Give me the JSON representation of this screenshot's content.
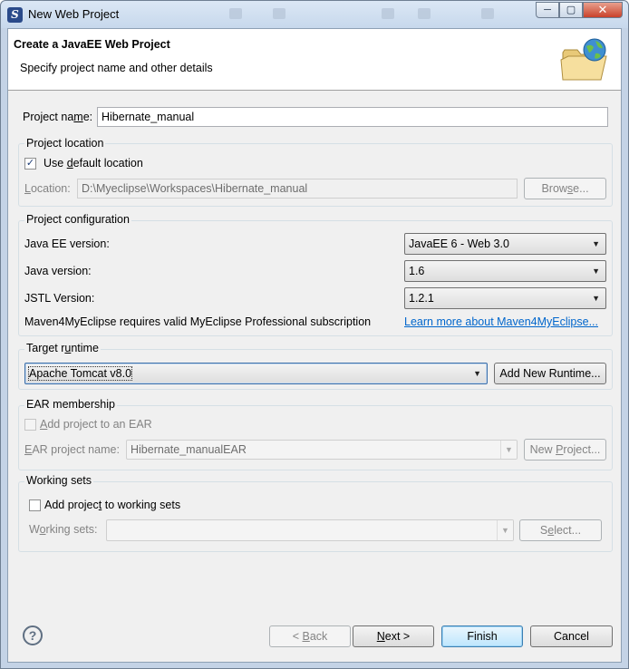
{
  "window": {
    "title": "New Web Project"
  },
  "window_controls": {
    "minimize": "─",
    "maximize": "▢",
    "close": "✕"
  },
  "banner": {
    "title": "Create a JavaEE Web Project",
    "subtitle": "Specify project name and other details"
  },
  "project_name": {
    "label_pre": "Project na",
    "label_mn": "m",
    "label_post": "e:",
    "value": "Hibernate_manual"
  },
  "project_location": {
    "group_title": "Project location",
    "use_default": {
      "pre": "Use ",
      "mn": "d",
      "post": "efault location",
      "checked": true
    },
    "location_label": {
      "mn": "L",
      "post": "ocation:"
    },
    "location_value": "D:\\Myeclipse\\Workspaces\\Hibernate_manual",
    "browse": {
      "pre": "Brow",
      "mn": "s",
      "post": "e..."
    }
  },
  "project_configuration": {
    "group_title": "Project configuration",
    "javaee_label": "Java EE version:",
    "javaee_value": "JavaEE 6 - Web 3.0",
    "java_label": "Java version:",
    "java_value": "1.6",
    "jstl_label": "JSTL Version:",
    "jstl_value": "1.2.1",
    "maven_note": "Maven4MyEclipse requires valid MyEclipse Professional subscription",
    "maven_link": "Learn more about Maven4MyEclipse..."
  },
  "target_runtime": {
    "group_title_pre": "Target r",
    "group_title_mn": "u",
    "group_title_post": "ntime",
    "value": "Apache Tomcat v8.0",
    "add_button": "Add New Runtime..."
  },
  "ear_membership": {
    "group_title": "EAR membership",
    "add_to_ear": {
      "mn": "A",
      "post": "dd project to an EAR",
      "checked": false
    },
    "ear_name_label": {
      "mn": "E",
      "post": "AR project name:"
    },
    "ear_name_value": "Hibernate_manualEAR",
    "new_project": {
      "pre": "New ",
      "mn": "P",
      "post": "roject..."
    }
  },
  "working_sets": {
    "group_title": "Working sets",
    "add_to_sets": {
      "pre": "Add projec",
      "mn": "t",
      "post": " to working sets",
      "checked": false
    },
    "sets_label": {
      "pre": "W",
      "mn": "o",
      "post": "rking sets:"
    },
    "sets_value": "",
    "select": {
      "pre": "S",
      "mn": "e",
      "post": "lect..."
    }
  },
  "footer": {
    "help_icon": "?",
    "back": {
      "pre": "< ",
      "mn": "B",
      "post": "ack"
    },
    "next": {
      "mn": "N",
      "post": "ext >"
    },
    "finish": "Finish",
    "cancel": "Cancel"
  },
  "icons": {
    "dropdown": "▼",
    "check": "✓"
  }
}
